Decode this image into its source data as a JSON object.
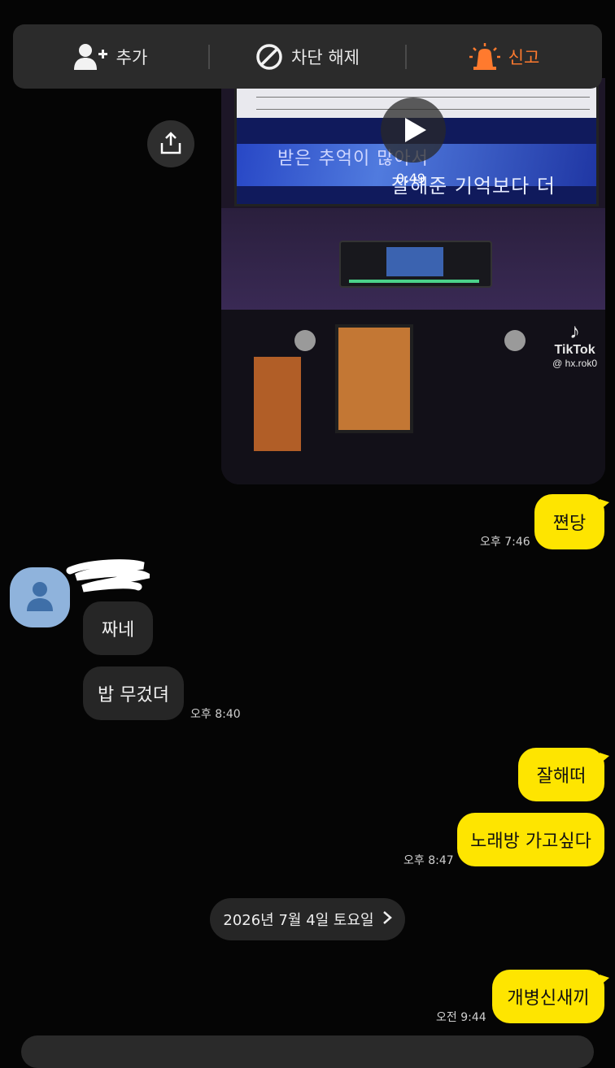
{
  "top_actions": {
    "add_label": "추가",
    "unblock_label": "차단 해제",
    "report_label": "신고"
  },
  "video": {
    "duration": "0:49",
    "lyric_line1": "받은 추억이 많아서",
    "lyric_line2": "잘해준 기억보다 더",
    "watermark_brand": "TikTok",
    "watermark_handle": "@ hx.rok0"
  },
  "messages": [
    {
      "from": "me",
      "text": "쪈당",
      "time": "오후 7:46"
    },
    {
      "from": "them",
      "text": "짜네",
      "time": ""
    },
    {
      "from": "them",
      "text": "밥 무겄뎌",
      "time": "오후 8:40"
    },
    {
      "from": "me",
      "text": "잘해떠",
      "time": ""
    },
    {
      "from": "me",
      "text": "노래방 가고싶다",
      "time": "오후 8:47"
    },
    {
      "from": "me",
      "text": "개병신새끼",
      "time": "오전 9:44"
    }
  ],
  "date_divider": "2026년 7월 4일 토요일",
  "colors": {
    "my_bubble": "#fee500",
    "their_bubble": "#262626",
    "report_accent": "#ff7a2e",
    "avatar_bg": "#8fb3dc"
  },
  "icons": [
    "add-friend-icon",
    "block-icon",
    "siren-icon",
    "share-icon",
    "play-icon",
    "profile-icon",
    "chevron-right-icon"
  ]
}
